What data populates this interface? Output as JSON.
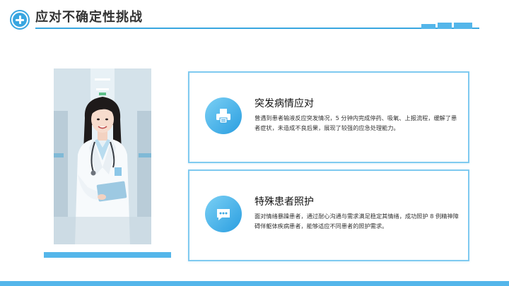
{
  "header": {
    "title": "应对不确定性挑战",
    "logo_icon": "medical-cross-icon",
    "accent_color": "#39a6e0"
  },
  "photo": {
    "description_icon": "doctor-photo"
  },
  "cards": [
    {
      "icon": "printer-icon",
      "title": "突发病情应对",
      "text": "曾遇到患者输液反应突发情况，5 分钟内完成停药、吸氧、上报流程，缓解了患者症状，未造成不良后果，展现了较强的应急处理能力。"
    },
    {
      "icon": "chat-bubble-icon",
      "title": "特殊患者照护",
      "text": "面对情绪暴躁患者，通过耐心沟通与需求满足稳定其情绪，成功照护 8 例精神障碍伴躯体疾病患者，能够适应不同患者的照护需求。"
    }
  ]
}
